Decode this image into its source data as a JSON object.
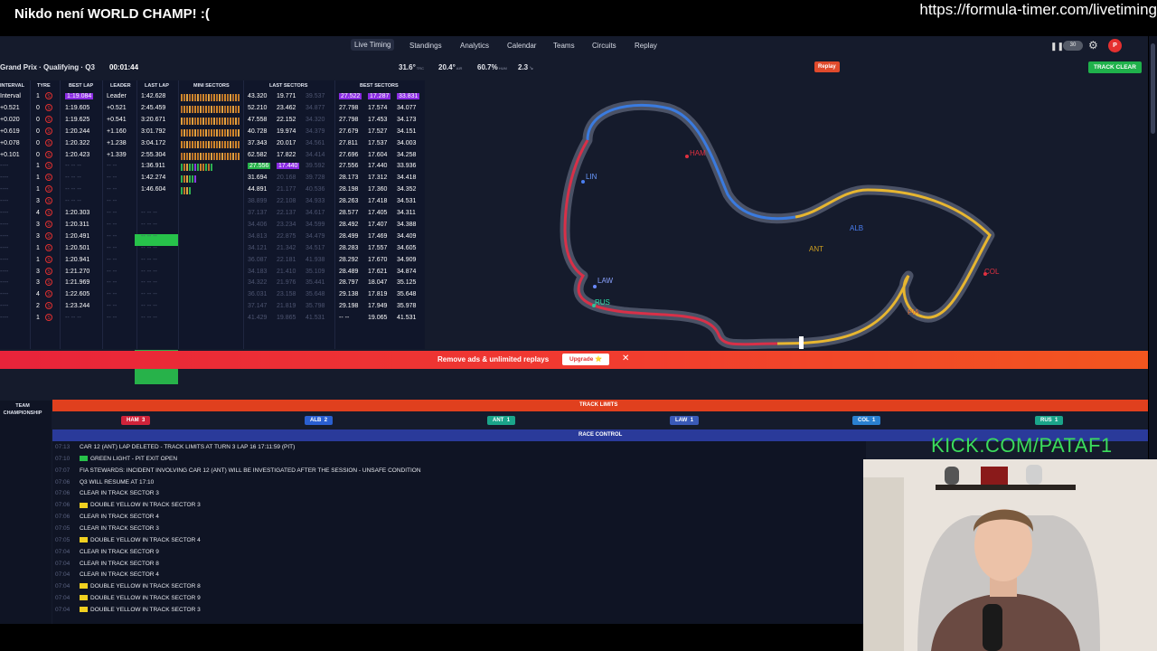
{
  "stream": {
    "title": "Nikdo není WORLD CHAMP! :(",
    "url": "https://formula-timer.com/livetiming",
    "kick": "KICK.COM/PATAF1"
  },
  "nav": {
    "links": [
      "Live Timing",
      "Standings",
      "Analytics",
      "Calendar",
      "Teams",
      "Circuits",
      "Replay"
    ],
    "active": "Live Timing",
    "playback_rate": "30",
    "avatar_initial": "P"
  },
  "session": {
    "name": "Grand Prix · Qualifying · Q3",
    "clock": "00:01:44",
    "track_temp": "31.6°",
    "track_temp_unit": "TRC",
    "air_temp": "20.4°",
    "air_temp_unit": "AIR",
    "humidity": "60.7%",
    "humidity_unit": "HUM",
    "wind": "2.3",
    "replay_label": "Replay",
    "track_status": "TRACK CLEAR"
  },
  "timing": {
    "headers": [
      "INTERVAL",
      "TYRE",
      "BEST LAP",
      "LEADER",
      "LAST LAP",
      "MINI SECTORS",
      "LAST SECTORS",
      "BEST SECTORS"
    ],
    "rows": [
      {
        "interval": "Interval",
        "laps": "1",
        "best": "1:19.084",
        "leader": "Leader",
        "last": "1:42.628",
        "ls": [
          "43.320",
          "19.771",
          "39.537"
        ],
        "bs": [
          "27.522",
          "17.287",
          "33.831"
        ],
        "best_purple": true,
        "bs_purple": true
      },
      {
        "interval": "+0.521",
        "laps": "0",
        "best": "1:19.605",
        "leader": "+0.521",
        "last": "2:45.459",
        "ls": [
          "52.210",
          "23.462",
          "34.877"
        ],
        "bs": [
          "27.798",
          "17.574",
          "34.077"
        ]
      },
      {
        "interval": "+0.020",
        "laps": "0",
        "best": "1:19.625",
        "leader": "+0.541",
        "last": "3:20.671",
        "ls": [
          "47.558",
          "22.152",
          "34.320"
        ],
        "bs": [
          "27.798",
          "17.453",
          "34.173"
        ]
      },
      {
        "interval": "+0.619",
        "laps": "0",
        "best": "1:20.244",
        "leader": "+1.160",
        "last": "3:01.792",
        "ls": [
          "40.728",
          "19.974",
          "34.379"
        ],
        "bs": [
          "27.679",
          "17.527",
          "34.151"
        ]
      },
      {
        "interval": "+0.078",
        "laps": "0",
        "best": "1:20.322",
        "leader": "+1.238",
        "last": "3:04.172",
        "ls": [
          "37.343",
          "20.017",
          "34.561"
        ],
        "bs": [
          "27.811",
          "17.537",
          "34.003"
        ]
      },
      {
        "interval": "+0.101",
        "laps": "0",
        "best": "1:20.423",
        "leader": "+1.339",
        "last": "2:55.304",
        "ls": [
          "62.582",
          "17.822",
          "34.414"
        ],
        "bs": [
          "27.696",
          "17.604",
          "34.258"
        ]
      },
      {
        "interval": "----",
        "laps": "1",
        "best": "-- -- --",
        "leader": "-- --",
        "last": "1:36.911",
        "ls": [
          "27.556",
          "17.440",
          "39.592"
        ],
        "bs": [
          "27.556",
          "17.440",
          "33.936"
        ],
        "ls_green": true
      },
      {
        "interval": "----",
        "laps": "1",
        "best": "-- -- --",
        "leader": "-- --",
        "last": "1:42.274",
        "ls": [
          "31.694",
          "20.168",
          "39.728"
        ],
        "bs": [
          "28.173",
          "17.312",
          "34.418"
        ]
      },
      {
        "interval": "----",
        "laps": "1",
        "best": "-- -- --",
        "leader": "-- --",
        "last": "1:46.604",
        "ls": [
          "44.891",
          "21.177",
          "40.536"
        ],
        "bs": [
          "28.198",
          "17.360",
          "34.352"
        ]
      },
      {
        "interval": "----",
        "laps": "3",
        "best": "-- -- --",
        "leader": "-- --",
        "last": "",
        "ls": [
          "38.899",
          "22.108",
          "34.933"
        ],
        "bs": [
          "28.263",
          "17.418",
          "34.531"
        ]
      },
      {
        "interval": "----",
        "laps": "4",
        "best": "1:20.303",
        "leader": "-- --",
        "last": "-- -- --",
        "ls": [
          "37.137",
          "22.137",
          "34.617"
        ],
        "bs": [
          "28.577",
          "17.405",
          "34.311"
        ]
      },
      {
        "interval": "----",
        "laps": "3",
        "best": "1:20.311",
        "leader": "-- --",
        "last": "-- -- --",
        "ls": [
          "34.406",
          "23.234",
          "34.599"
        ],
        "bs": [
          "28.492",
          "17.407",
          "34.388"
        ]
      },
      {
        "interval": "----",
        "laps": "3",
        "best": "1:20.491",
        "leader": "-- --",
        "last": "-- -- --",
        "ls": [
          "34.813",
          "22.875",
          "34.479"
        ],
        "bs": [
          "28.499",
          "17.469",
          "34.409"
        ]
      },
      {
        "interval": "----",
        "laps": "1",
        "best": "1:20.501",
        "leader": "-- --",
        "last": "-- -- --",
        "ls": [
          "34.121",
          "21.342",
          "34.517"
        ],
        "bs": [
          "28.283",
          "17.557",
          "34.605"
        ]
      },
      {
        "interval": "----",
        "laps": "1",
        "best": "1:20.941",
        "leader": "-- --",
        "last": "-- -- --",
        "ls": [
          "36.087",
          "22.181",
          "41.938"
        ],
        "bs": [
          "28.292",
          "17.670",
          "34.909"
        ]
      },
      {
        "interval": "----",
        "laps": "3",
        "best": "1:21.270",
        "leader": "-- --",
        "last": "-- -- --",
        "ls": [
          "34.183",
          "21.410",
          "35.109"
        ],
        "bs": [
          "28.489",
          "17.621",
          "34.874"
        ]
      },
      {
        "interval": "----",
        "laps": "3",
        "best": "1:21.969",
        "leader": "-- --",
        "last": "-- -- --",
        "ls": [
          "34.322",
          "21.976",
          "35.441"
        ],
        "bs": [
          "28.797",
          "18.047",
          "35.125"
        ]
      },
      {
        "interval": "----",
        "laps": "4",
        "best": "1:22.605",
        "leader": "-- --",
        "last": "-- -- --",
        "ls": [
          "36.031",
          "23.158",
          "35.648"
        ],
        "bs": [
          "29.138",
          "17.819",
          "35.648"
        ]
      },
      {
        "interval": "----",
        "laps": "2",
        "best": "1:23.244",
        "leader": "-- --",
        "last": "-- -- --",
        "ls": [
          "37.147",
          "21.819",
          "35.798"
        ],
        "bs": [
          "29.198",
          "17.949",
          "35.978"
        ]
      },
      {
        "interval": "----",
        "laps": "1",
        "best": "-- -- --",
        "leader": "-- --",
        "last": "-- -- --",
        "ls": [
          "41.429",
          "19.865",
          "41.531"
        ],
        "bs": [
          "-- --",
          "19.065",
          "41.531"
        ]
      }
    ]
  },
  "map": {
    "labels": [
      "LIN",
      "ANT",
      "LAW",
      "RUS",
      "ALB",
      "HAM",
      "COL",
      "PIA"
    ]
  },
  "banner": {
    "text": "Remove ads & unlimited replays",
    "upgrade": "Upgrade ⭐",
    "close": "✕"
  },
  "lower": {
    "team_label": "TEAM CHAMPIONSHIP",
    "track_limits_title": "TRACK LIMITS",
    "track_limits": [
      {
        "code": "HAM",
        "count": "3",
        "color": "#d0233a"
      },
      {
        "code": "ALB",
        "count": "2",
        "color": "#2a5fd0"
      },
      {
        "code": "ANT",
        "count": "1",
        "color": "#1ba58a"
      },
      {
        "code": "LAW",
        "count": "1",
        "color": "#3a5ab8"
      },
      {
        "code": "COL",
        "count": "1",
        "color": "#2a80d0"
      },
      {
        "code": "RUS",
        "count": "1",
        "color": "#1ba58a"
      }
    ],
    "race_control_title": "RACE CONTROL",
    "race_control": [
      {
        "time": "07:13",
        "msg": "CAR 12 (ANT) LAP DELETED - TRACK LIMITS AT TURN 3 LAP 16 17:11:59 (PIT)",
        "flag": ""
      },
      {
        "time": "07:10",
        "msg": "GREEN LIGHT - PIT EXIT OPEN",
        "flag": "green"
      },
      {
        "time": "07:07",
        "msg": "FIA STEWARDS: INCIDENT INVOLVING CAR 12 (ANT) WILL BE INVESTIGATED AFTER THE SESSION - UNSAFE CONDITION",
        "flag": ""
      },
      {
        "time": "07:06",
        "msg": "Q3 WILL RESUME AT 17:10",
        "flag": ""
      },
      {
        "time": "07:06",
        "msg": "CLEAR IN TRACK SECTOR 3",
        "flag": ""
      },
      {
        "time": "07:06",
        "msg": "DOUBLE YELLOW IN TRACK SECTOR 3",
        "flag": "yellow"
      },
      {
        "time": "07:06",
        "msg": "CLEAR IN TRACK SECTOR 4",
        "flag": ""
      },
      {
        "time": "07:05",
        "msg": "CLEAR IN TRACK SECTOR 3",
        "flag": ""
      },
      {
        "time": "07:05",
        "msg": "DOUBLE YELLOW IN TRACK SECTOR 4",
        "flag": "yellow"
      },
      {
        "time": "07:04",
        "msg": "CLEAR IN TRACK SECTOR 9",
        "flag": ""
      },
      {
        "time": "07:04",
        "msg": "CLEAR IN TRACK SECTOR 8",
        "flag": ""
      },
      {
        "time": "07:04",
        "msg": "CLEAR IN TRACK SECTOR 4",
        "flag": ""
      },
      {
        "time": "07:04",
        "msg": "DOUBLE YELLOW IN TRACK SECTOR 8",
        "flag": "yellow"
      },
      {
        "time": "07:04",
        "msg": "DOUBLE YELLOW IN TRACK SECTOR 9",
        "flag": "yellow"
      },
      {
        "time": "07:04",
        "msg": "DOUBLE YELLOW IN TRACK SECTOR 3",
        "flag": "yellow"
      }
    ]
  },
  "colors": {
    "accent_purple": "#8a2be2",
    "accent_green": "#27b24a",
    "tyre_red": "#e03030",
    "banner_red": "#f03a30",
    "race_control_blue": "#2a3a9a",
    "track_limits_orange": "#e0401e"
  }
}
